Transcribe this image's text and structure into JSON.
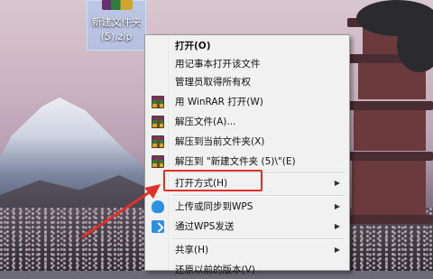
{
  "desktop_icon": {
    "label_line1": "新建文件夹",
    "label_line2": "(5).zip"
  },
  "menu": {
    "items": [
      {
        "label": "打开(O)",
        "bold": true,
        "icon": ""
      },
      {
        "label": "用记事本打开该文件",
        "icon": ""
      },
      {
        "label": "管理员取得所有权",
        "icon": ""
      },
      {
        "label": "用 WinRAR 打开(W)",
        "icon": "winrar-icon"
      },
      {
        "label": "解压文件(A)...",
        "icon": "winrar-icon"
      },
      {
        "label": "解压到当前文件夹(X)",
        "icon": "winrar-icon"
      },
      {
        "label": "解压到 \"新建文件夹 (5)\\\"(E)",
        "icon": "winrar-icon"
      },
      {
        "label": "打开方式(H)",
        "icon": "",
        "submenu": true
      },
      {
        "label": "上传或同步到WPS",
        "icon": "wps-cloud-icon",
        "submenu": true
      },
      {
        "label": "通过WPS发送",
        "icon": "wps-send-icon",
        "submenu": true
      },
      {
        "label": "共享(H)",
        "icon": "",
        "submenu": true
      },
      {
        "label": "还原以前的版本(V)",
        "icon": ""
      }
    ],
    "submenu_arrow": "▶"
  },
  "annotation": {
    "highlight_color": "#e0302a"
  }
}
